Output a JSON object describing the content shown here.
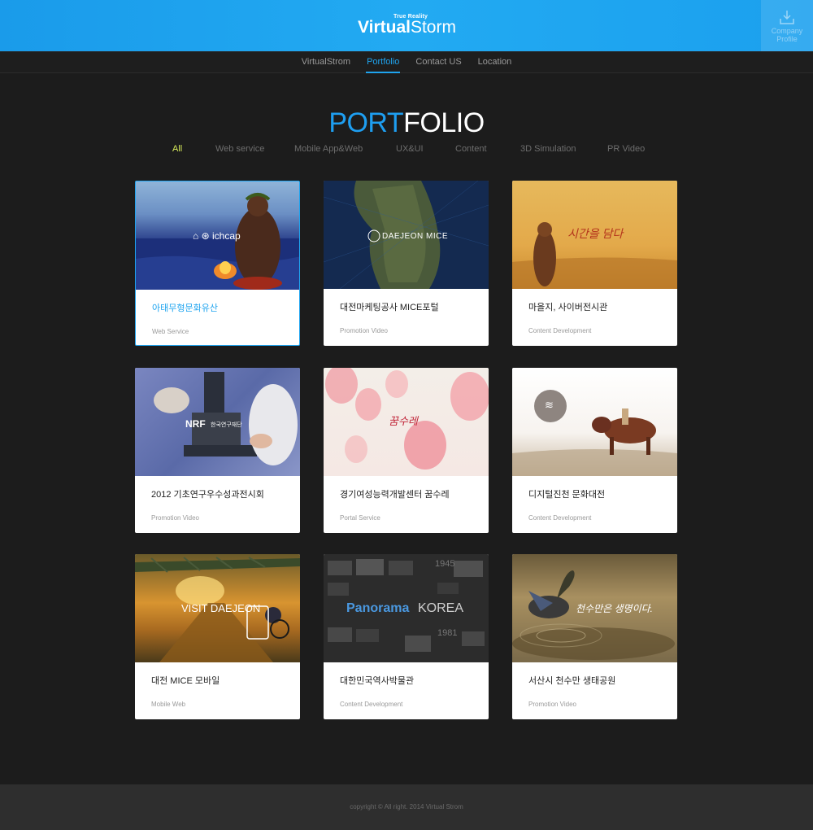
{
  "header": {
    "logo_tag": "True Reality",
    "logo_bold": "Virtual",
    "logo_light": "Storm",
    "profile_label_1": "Company",
    "profile_label_2": "Profile"
  },
  "nav": {
    "items": [
      {
        "label": "VirtualStrom"
      },
      {
        "label": "Portfolio"
      },
      {
        "label": "Contact US"
      },
      {
        "label": "Location"
      }
    ],
    "active": "Portfolio"
  },
  "title": {
    "part1": "PORT",
    "part2": "FOLIO"
  },
  "filters": [
    {
      "label": "All"
    },
    {
      "label": "Web service"
    },
    {
      "label": "Mobile App&Web"
    },
    {
      "label": "UX&UI"
    },
    {
      "label": "Content"
    },
    {
      "label": "3D Simulation"
    },
    {
      "label": "PR Video"
    }
  ],
  "cards": [
    {
      "title": "아태무형문화유산",
      "category": "Web Service",
      "overlay": "ichcap"
    },
    {
      "title": "대전마케팅공사 MICE포털",
      "category": "Promotion Video",
      "overlay": "DAEJEON  MICE"
    },
    {
      "title": "마을지, 사이버전시관",
      "category": "Content Development",
      "overlay": "시간을 담다"
    },
    {
      "title": "2012 기초연구우수성과전시회",
      "category": "Promotion Video",
      "overlay": "NRF",
      "overlay2": "한국연구재단"
    },
    {
      "title": "경기여성능력개발센터 꿈수레",
      "category": "Portal Service",
      "overlay": "꿈수레"
    },
    {
      "title": "디지털진천 문화대전",
      "category": "Content Development",
      "overlay": "≋"
    },
    {
      "title": "대전 MICE 모바일",
      "category": "Mobile Web",
      "overlay": "VISIT DAEJEON"
    },
    {
      "title": "대한민국역사박물관",
      "category": "Content Development",
      "overlay": "Panorama",
      "overlay2": "KOREA",
      "overlay3": "1945",
      "overlay4": "1981"
    },
    {
      "title": "서산시 천수만 생태공원",
      "category": "Promotion Video",
      "overlay": "천수만은 생명이다."
    }
  ],
  "footer": {
    "copyright": "copyright © All right. 2014 Virtual Strom"
  },
  "colors": {
    "accent": "#1fa4ef",
    "filter_active": "#d9ed5b",
    "background": "#1c1c1c"
  }
}
